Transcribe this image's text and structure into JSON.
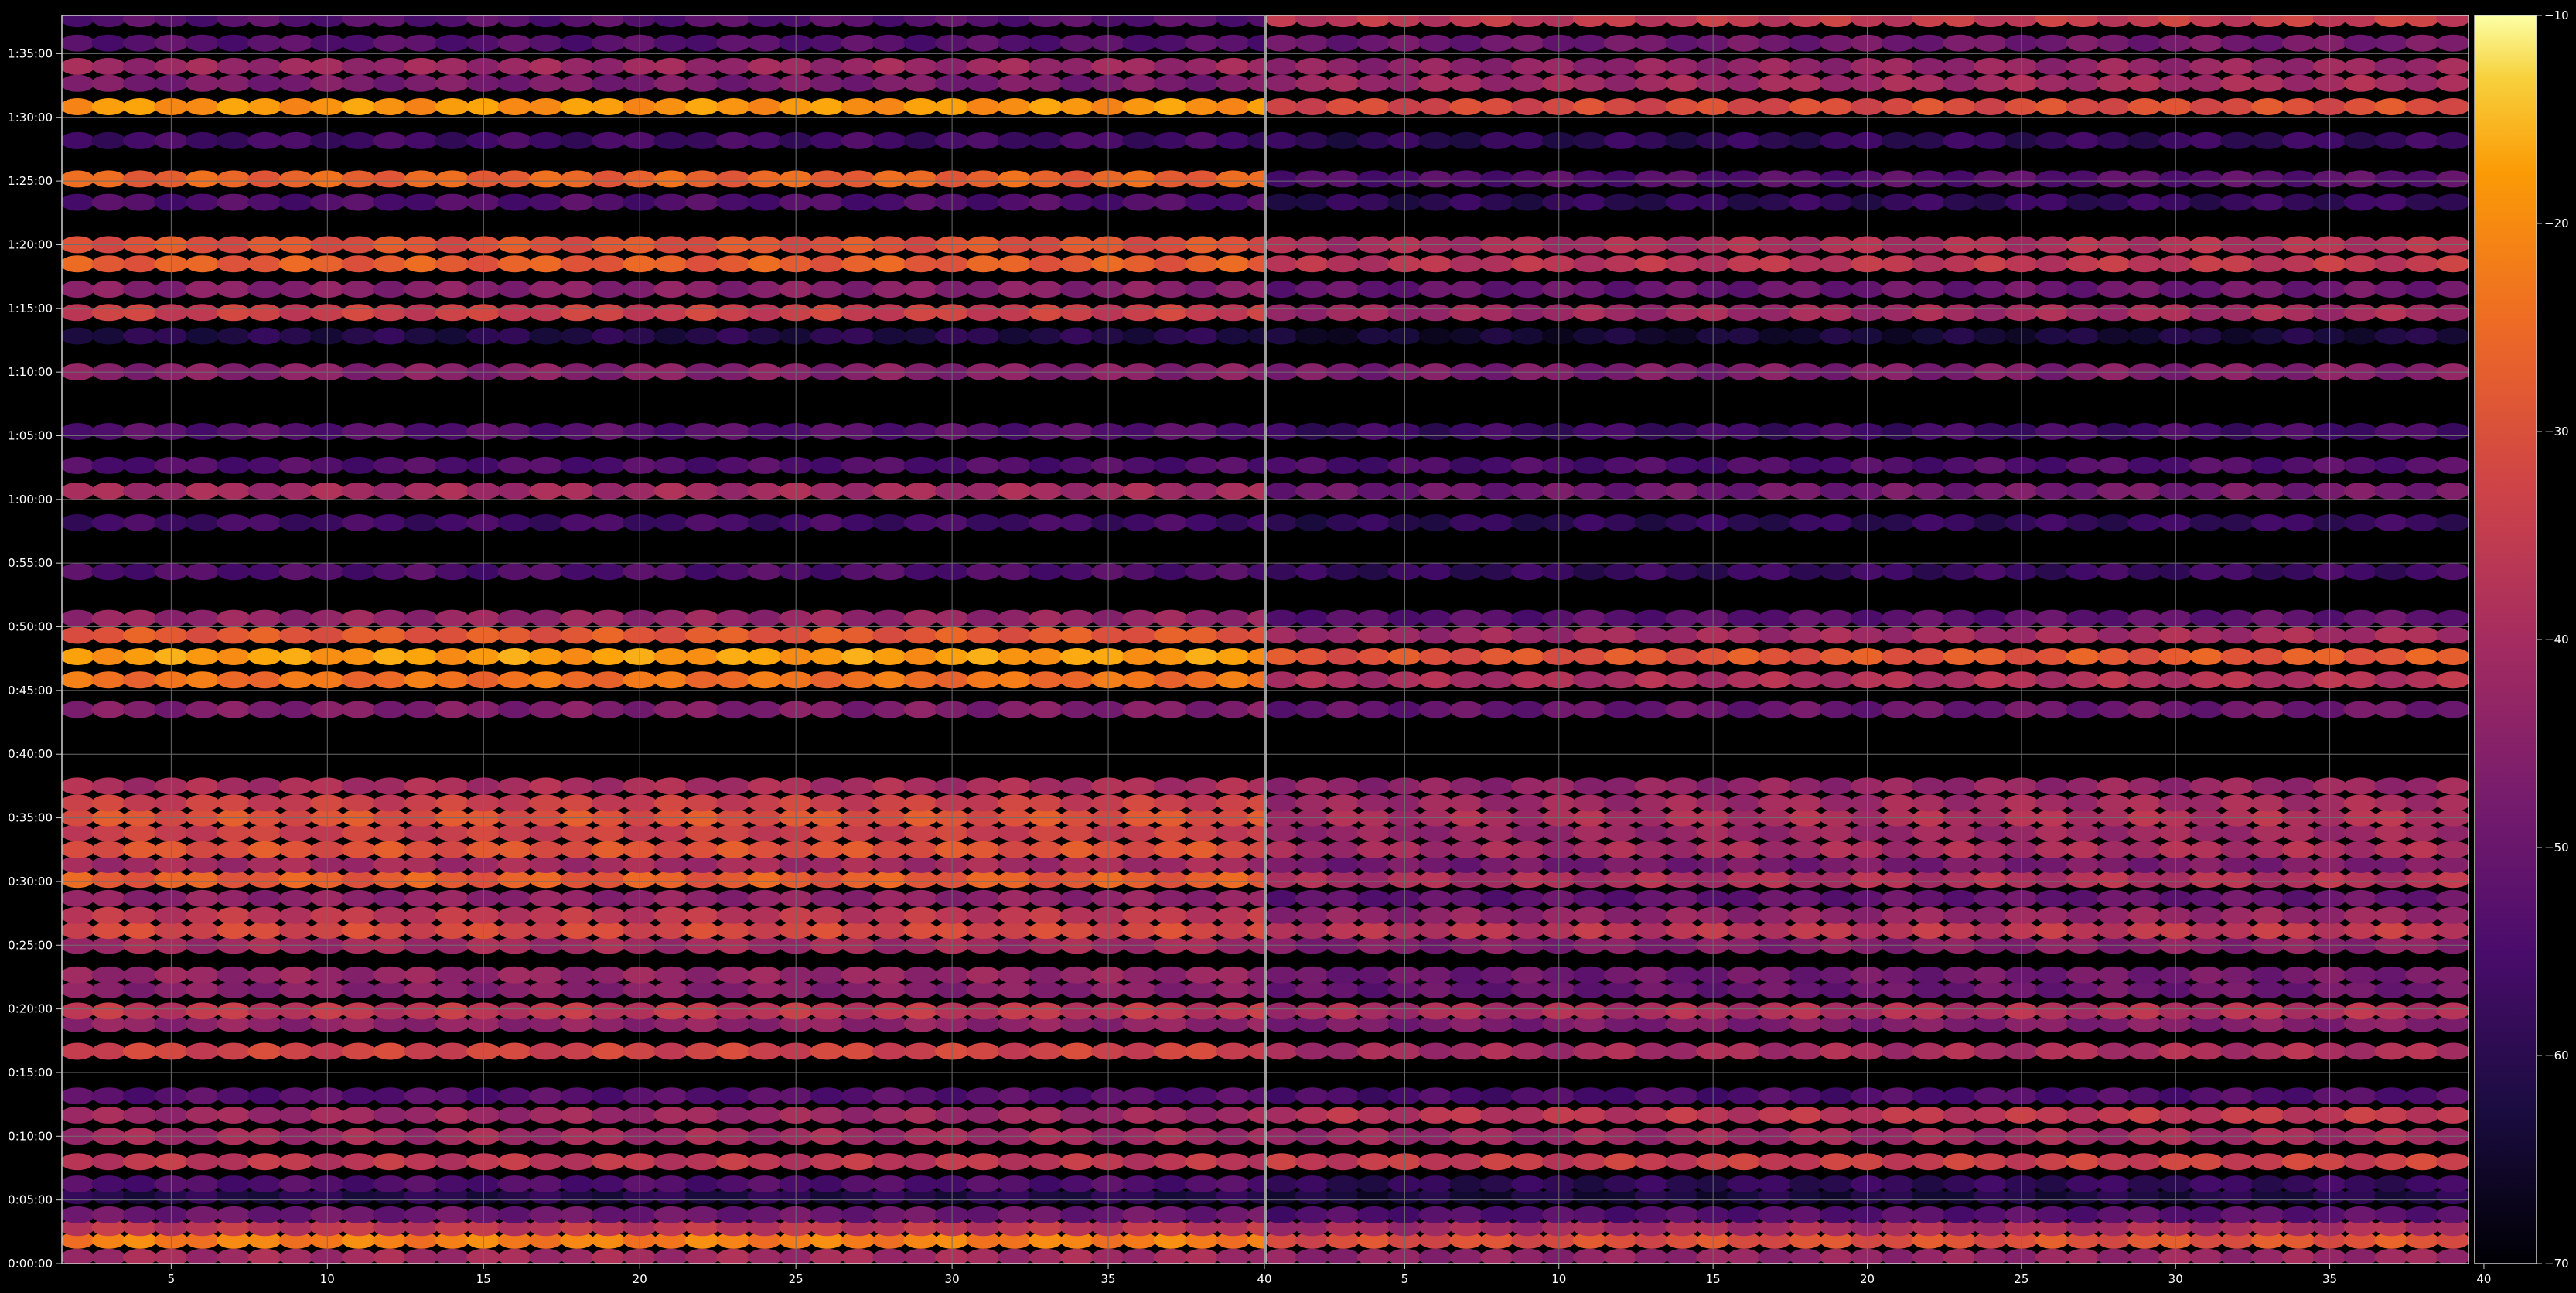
{
  "chart_data": {
    "type": "heatmap",
    "title": "",
    "xlabel": "",
    "ylabel": "",
    "panels": [
      {
        "name": "",
        "xlim": [
          1.5,
          40
        ],
        "x_ticks": [
          5,
          10,
          15,
          20,
          25,
          30,
          35,
          40
        ]
      },
      {
        "name": "",
        "xlim": [
          0.5,
          39.5
        ],
        "x_ticks": [
          5,
          10,
          15,
          20,
          25,
          30,
          35,
          40
        ]
      }
    ],
    "y_axis": {
      "unit": "seconds",
      "range": [
        0,
        5880
      ],
      "ticks": [
        0,
        300,
        600,
        900,
        1200,
        1500,
        1800,
        2100,
        2400,
        2700,
        3000,
        3300,
        3600,
        3900,
        4200,
        4500,
        4800,
        5100,
        5400,
        5700
      ],
      "tick_labels": [
        "0:00:00",
        "0:05:00",
        "0:10:00",
        "0:15:00",
        "0:20:00",
        "0:25:00",
        "0:30:00",
        "0:35:00",
        "0:40:00",
        "0:45:00",
        "0:50:00",
        "0:55:00",
        "1:00:00",
        "1:05:00",
        "1:10:00",
        "1:15:00",
        "1:20:00",
        "1:25:00",
        "1:30:00",
        "1:35:00"
      ]
    },
    "colorbar": {
      "colormap": "inferno",
      "range": [
        -70,
        -10
      ],
      "ticks": [
        -70,
        -60,
        -50,
        -40,
        -30,
        -20,
        -10
      ],
      "tick_labels": [
        "−70",
        "−60",
        "−50",
        "−40",
        "−30",
        "−20",
        "−10"
      ]
    },
    "grid": true,
    "background": "#000000",
    "grid_color": "#6e6e6e",
    "bands": [
      {
        "t": 30,
        "a": -44,
        "b": -46
      },
      {
        "t": 110,
        "a": -27,
        "b": -34
      },
      {
        "t": 170,
        "a": -40,
        "b": -43
      },
      {
        "t": 230,
        "a": -52,
        "b": -55
      },
      {
        "t": 320,
        "a": -62,
        "b": -63
      },
      {
        "t": 375,
        "a": -56,
        "b": -60
      },
      {
        "t": 480,
        "a": -40,
        "b": -38
      },
      {
        "t": 600,
        "a": -44,
        "b": -44
      },
      {
        "t": 700,
        "a": -45,
        "b": -40
      },
      {
        "t": 790,
        "a": -55,
        "b": -56
      },
      {
        "t": 1000,
        "a": -37,
        "b": -43
      },
      {
        "t": 1130,
        "a": -47,
        "b": -49
      },
      {
        "t": 1190,
        "a": -40,
        "b": -42
      },
      {
        "t": 1290,
        "a": -48,
        "b": -52
      },
      {
        "t": 1360,
        "a": -46,
        "b": -51
      },
      {
        "t": 1500,
        "a": -44,
        "b": -48
      },
      {
        "t": 1570,
        "a": -36,
        "b": -40
      },
      {
        "t": 1640,
        "a": -40,
        "b": -46
      },
      {
        "t": 1720,
        "a": -47,
        "b": -53
      },
      {
        "t": 1810,
        "a": -32,
        "b": -42
      },
      {
        "t": 1880,
        "a": -44,
        "b": -50
      },
      {
        "t": 1950,
        "a": -34,
        "b": -43
      },
      {
        "t": 2030,
        "a": -38,
        "b": -45
      },
      {
        "t": 2100,
        "a": -34,
        "b": -42
      },
      {
        "t": 2170,
        "a": -38,
        "b": -44
      },
      {
        "t": 2250,
        "a": -43,
        "b": -46
      },
      {
        "t": 2610,
        "a": -49,
        "b": -52
      },
      {
        "t": 2750,
        "a": -29,
        "b": -42
      },
      {
        "t": 2860,
        "a": -23,
        "b": -33
      },
      {
        "t": 2960,
        "a": -33,
        "b": -44
      },
      {
        "t": 3040,
        "a": -46,
        "b": -54
      },
      {
        "t": 3260,
        "a": -56,
        "b": -59
      },
      {
        "t": 3490,
        "a": -58,
        "b": -60
      },
      {
        "t": 3640,
        "a": -44,
        "b": -51
      },
      {
        "t": 3760,
        "a": -56,
        "b": -56
      },
      {
        "t": 3920,
        "a": -55,
        "b": -58
      },
      {
        "t": 4200,
        "a": -48,
        "b": -49
      },
      {
        "t": 4370,
        "a": -62,
        "b": -64
      },
      {
        "t": 4480,
        "a": -38,
        "b": -44
      },
      {
        "t": 4590,
        "a": -48,
        "b": -52
      },
      {
        "t": 4710,
        "a": -32,
        "b": -40
      },
      {
        "t": 4800,
        "a": -34,
        "b": -42
      },
      {
        "t": 5000,
        "a": -56,
        "b": -60
      },
      {
        "t": 5110,
        "a": -31,
        "b": -55
      },
      {
        "t": 5290,
        "a": -58,
        "b": -60
      },
      {
        "t": 5450,
        "a": -24,
        "b": -35
      },
      {
        "t": 5560,
        "a": -50,
        "b": -44
      },
      {
        "t": 5640,
        "a": -45,
        "b": -46
      },
      {
        "t": 5750,
        "a": -55,
        "b": -51
      },
      {
        "t": 5865,
        "a": -55,
        "b": -39
      }
    ]
  }
}
